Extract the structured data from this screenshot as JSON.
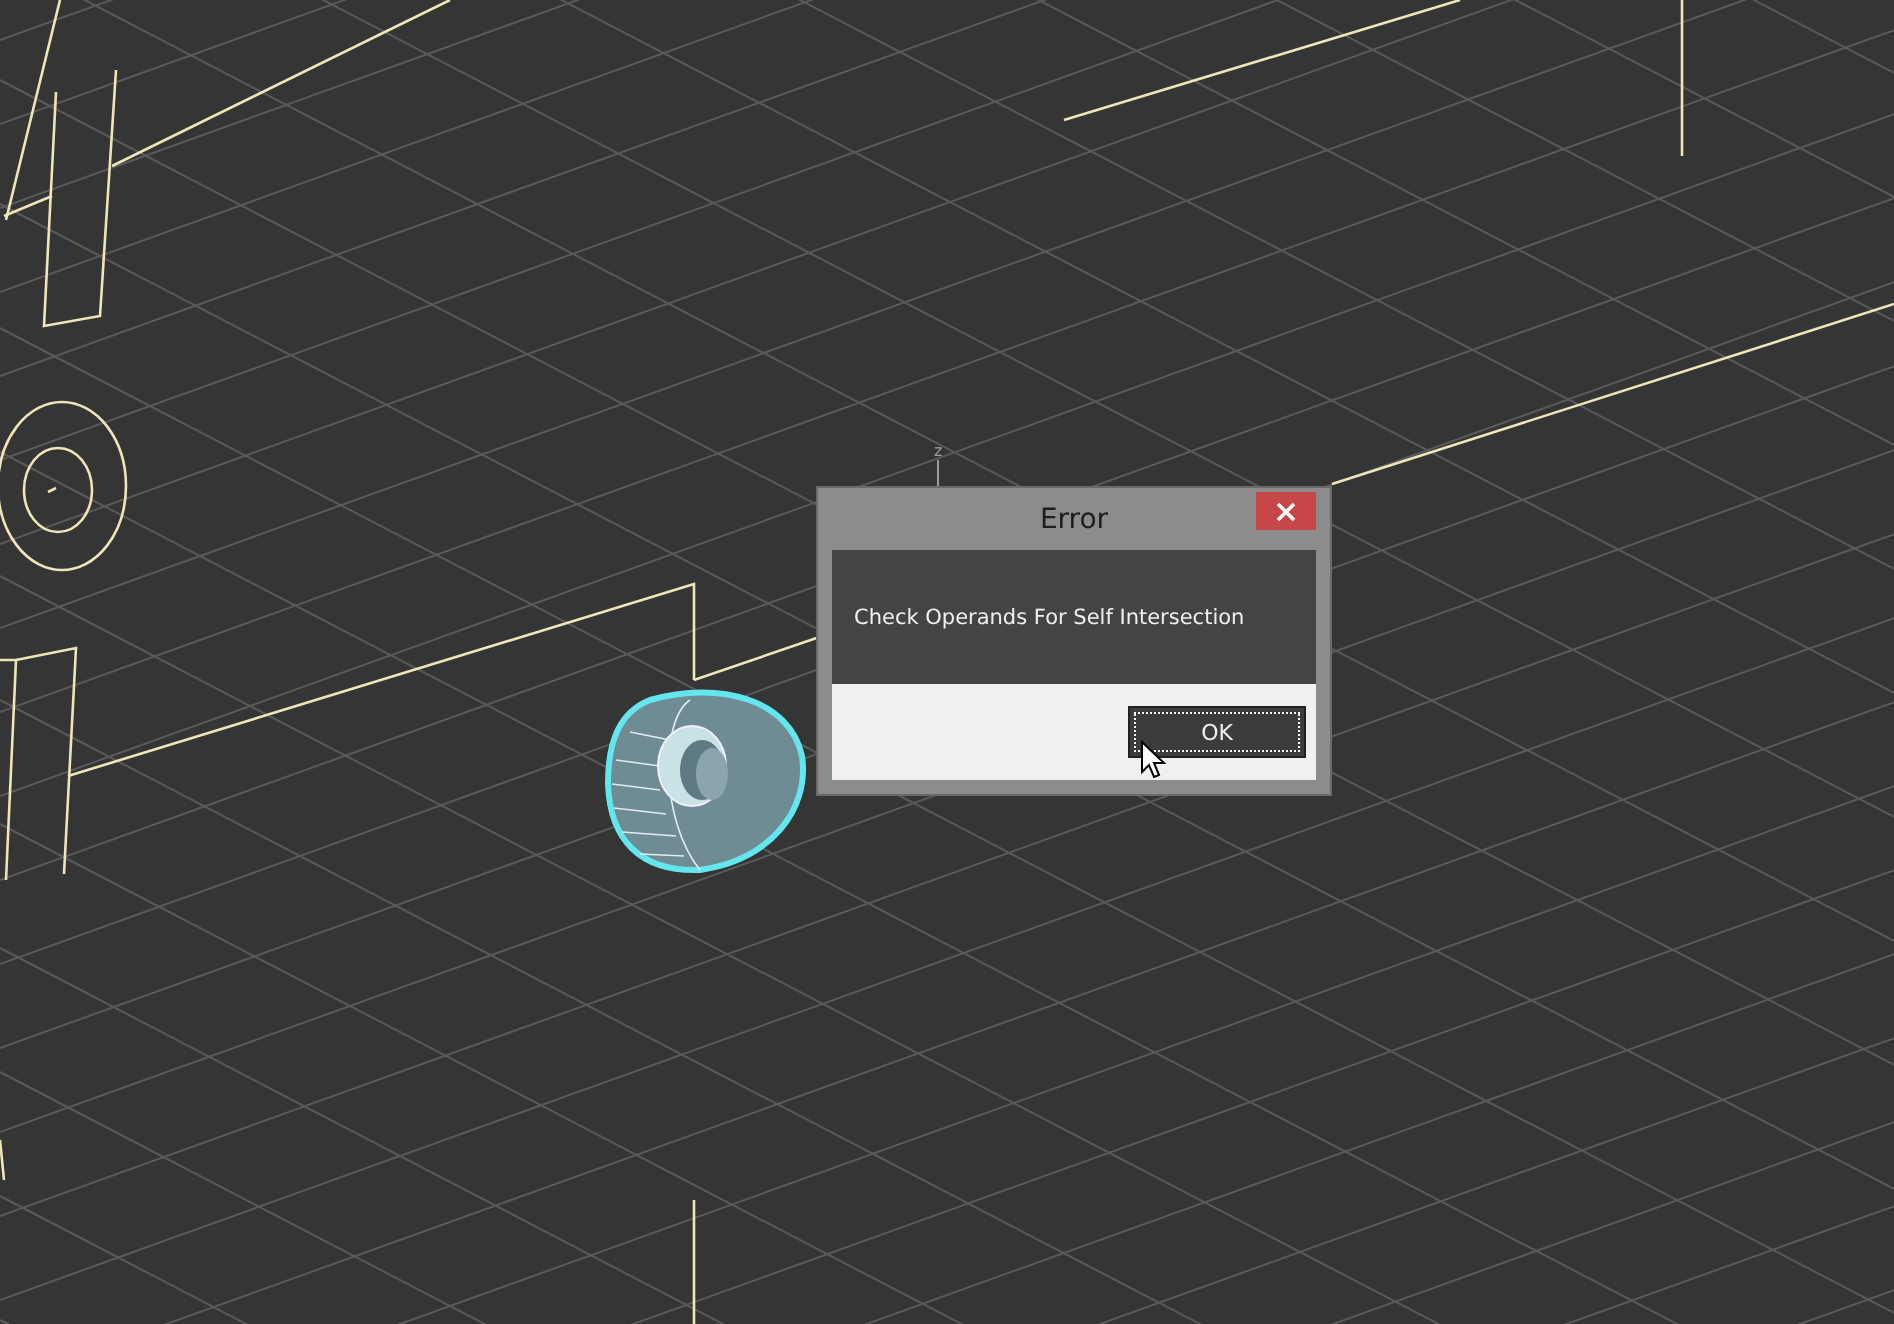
{
  "viewport": {
    "axis_label": "z"
  },
  "dialog": {
    "title": "Error",
    "message": "Check Operands For Self Intersection",
    "buttons": [
      {
        "label": "OK",
        "focused": true
      }
    ]
  }
}
